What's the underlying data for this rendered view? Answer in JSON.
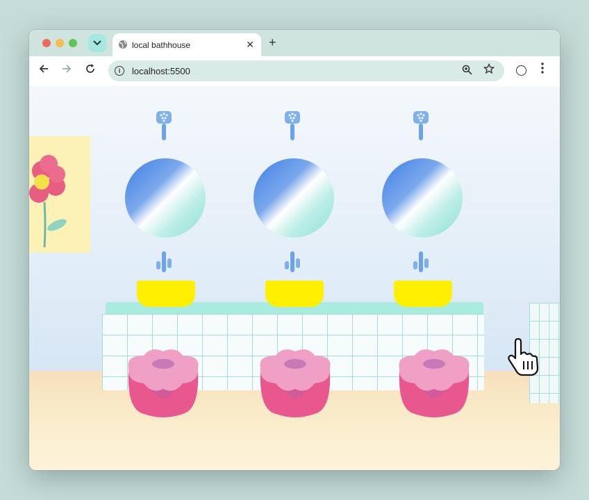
{
  "browser": {
    "tab_title": "local bathhouse",
    "url": "localhost:5500",
    "new_tab_symbol": "+",
    "close_symbol": "✕",
    "icons": [
      "tab-search-icon",
      "globe-icon",
      "back-arrow-icon",
      "forward-arrow-icon",
      "reload-icon",
      "info-icon",
      "zoom-icon",
      "star-icon",
      "profile-icon",
      "menu-icon"
    ]
  },
  "scene": {
    "stations": [
      "left",
      "middle",
      "right"
    ],
    "colors": {
      "basin": "#fff000",
      "stool": "#e8588e",
      "mirror_blue": "#3f7fe6",
      "mirror_mint": "#8fe1d6",
      "counter_top": "#a8ece0",
      "tile_grout": "#9fdedd",
      "flower_petal": "#e85d82"
    },
    "cursor": "hand-pointer-icon"
  }
}
